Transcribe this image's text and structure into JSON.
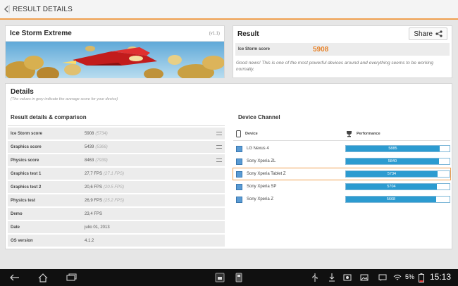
{
  "topbar": {
    "title": "RESULT DETAILS"
  },
  "test_panel": {
    "name": "Ice Storm Extreme",
    "version": "(v1.1)"
  },
  "result_panel": {
    "title": "Result",
    "share_label": "Share",
    "score_label": "Ice Storm score",
    "score_value": "5908",
    "message": "Good news! This is one of the most powerful devices around and everything seems to be working normally."
  },
  "details": {
    "title": "Details",
    "subtitle": "(The values in grey indicate the average score for your device)",
    "comparison_title": "Result details & comparison",
    "rows": [
      {
        "label": "Ice Storm score",
        "value": "5908",
        "avg": "(5734)"
      },
      {
        "label": "Graphics score",
        "value": "5439",
        "avg": "(5366)"
      },
      {
        "label": "Physics score",
        "value": "8463",
        "avg": "(7939)"
      },
      {
        "label": "Graphics test 1",
        "value": "27,7 FPS",
        "avg": "(27.1 FPS)"
      },
      {
        "label": "Graphics test 2",
        "value": "20,6 FPS",
        "avg": "(20.5 FPS)"
      },
      {
        "label": "Physics test",
        "value": "26,9 FPS",
        "avg": "(25.2 FPS)"
      },
      {
        "label": "Demo",
        "value": "23,4 FPS",
        "avg": ""
      },
      {
        "label": "Date",
        "value": "julio 01, 2013",
        "avg": ""
      },
      {
        "label": "OS version",
        "value": "4.1.2",
        "avg": ""
      }
    ]
  },
  "device_channel": {
    "title": "Device Channel",
    "col_device": "Device",
    "col_performance": "Performance",
    "max_scale": 6500,
    "devices": [
      {
        "name": "LG Nexus 4",
        "score": "5885",
        "value": 5885,
        "highlight": false
      },
      {
        "name": "Sony Xperia ZL",
        "score": "5840",
        "value": 5840,
        "highlight": false
      },
      {
        "name": "Sony Xperia Tablet Z",
        "score": "5734",
        "value": 5734,
        "highlight": true
      },
      {
        "name": "Sony Xperia SP",
        "score": "5704",
        "value": 5704,
        "highlight": false
      },
      {
        "name": "Sony Xperia Z",
        "score": "5668",
        "value": 5668,
        "highlight": false
      }
    ]
  },
  "statusbar": {
    "battery": "5%",
    "time": "15:13"
  },
  "colors": {
    "accent": "#e8832a",
    "bar": "#2c9bd0"
  }
}
